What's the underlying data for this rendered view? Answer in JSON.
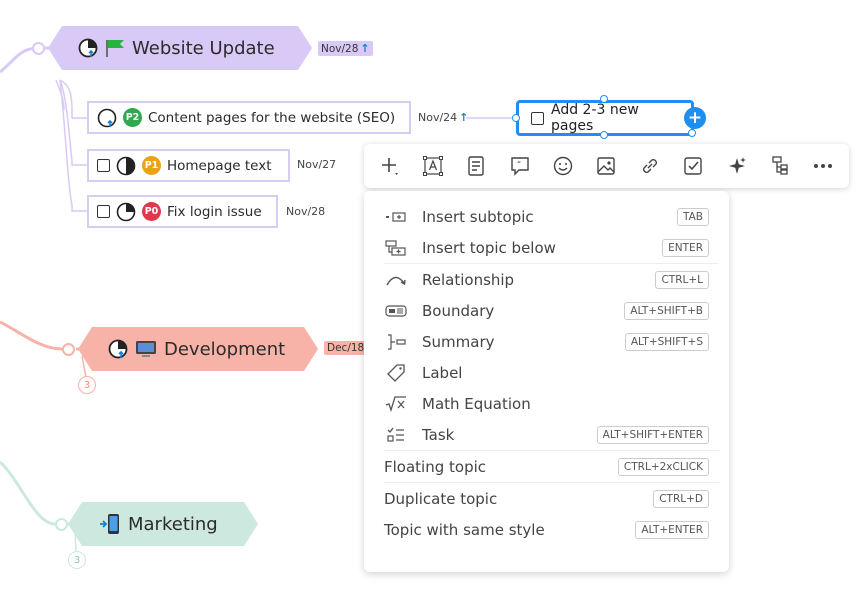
{
  "colors": {
    "purple_branch": "#d9c9f6",
    "red_branch": "#f7b3a8",
    "teal_branch": "#cde8de",
    "selection": "#1e8ff0",
    "p0": "#e0394d",
    "p1": "#e8a317",
    "p2": "#2fa84f"
  },
  "topics": {
    "website_update": {
      "label": "Website Update",
      "date": "Nov/28",
      "icons": [
        "progress-pie-icon",
        "green-flag-icon"
      ]
    },
    "development": {
      "label": "Development",
      "date": "Dec/18",
      "count": "3",
      "icons": [
        "progress-pie-icon",
        "computer-icon"
      ]
    },
    "marketing": {
      "label": "Marketing",
      "count": "3",
      "icons": [
        "mobile-phone-icon"
      ]
    }
  },
  "subtopics": [
    {
      "label": "Content pages for the website (SEO)",
      "priority": "P2",
      "date": "Nov/24"
    },
    {
      "label": "Homepage text",
      "priority": "P1",
      "date": "Nov/27"
    },
    {
      "label": "Fix login issue",
      "priority": "P0",
      "date": "Nov/28"
    }
  ],
  "selected_topic": {
    "label": "Add 2-3 new pages"
  },
  "toolbar": {
    "buttons": [
      "insert-plus-icon",
      "text-style-icon",
      "notes-icon",
      "comment-icon",
      "emoji-icon",
      "image-icon",
      "link-icon",
      "task-checkbox-icon",
      "ai-sparkle-icon",
      "structure-icon",
      "more-icon"
    ]
  },
  "menu": {
    "items": [
      {
        "label": "Insert subtopic",
        "shortcut": "TAB",
        "icon": "insert-subtopic-icon"
      },
      {
        "label": "Insert topic below",
        "shortcut": "ENTER",
        "icon": "insert-below-icon"
      },
      {
        "label": "Relationship",
        "shortcut": "CTRL+L",
        "icon": "relationship-icon"
      },
      {
        "label": "Boundary",
        "shortcut": "ALT+SHIFT+B",
        "icon": "boundary-icon"
      },
      {
        "label": "Summary",
        "shortcut": "ALT+SHIFT+S",
        "icon": "summary-icon"
      },
      {
        "label": "Label",
        "shortcut": "",
        "icon": "label-tag-icon"
      },
      {
        "label": "Math Equation",
        "shortcut": "",
        "icon": "math-equation-icon"
      },
      {
        "label": "Task",
        "shortcut": "ALT+SHIFT+ENTER",
        "icon": "task-list-icon"
      },
      {
        "label": "Floating topic",
        "shortcut": "CTRL+2xCLICK"
      },
      {
        "label": "Duplicate topic",
        "shortcut": "CTRL+D"
      },
      {
        "label": "Topic with same style",
        "shortcut": "ALT+ENTER"
      }
    ]
  }
}
